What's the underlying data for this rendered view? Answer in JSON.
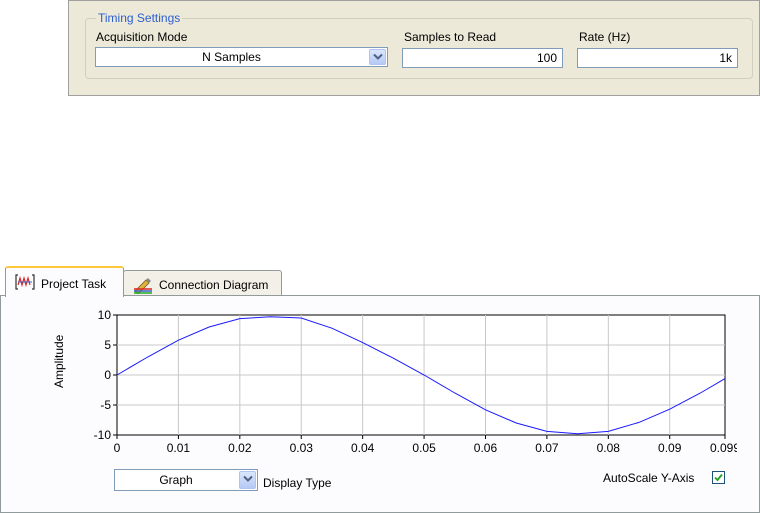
{
  "timing": {
    "group_title": "Timing Settings",
    "acq_mode_label": "Acquisition Mode",
    "acq_mode_value": "N Samples",
    "samples_label": "Samples to Read",
    "samples_value": "100",
    "rate_label": "Rate (Hz)",
    "rate_value": "1k"
  },
  "tabs": [
    {
      "label": "Project Task",
      "icon": "waveform-icon",
      "active": true
    },
    {
      "label": "Connection Diagram",
      "icon": "pencil-wiring-icon",
      "active": false
    }
  ],
  "controls": {
    "display_type_value": "Graph",
    "display_type_label": "Display Type",
    "autoscale_label": "AutoScale Y-Axis",
    "autoscale_checked": true
  },
  "chart_data": {
    "type": "line",
    "ylabel": "Amplitude",
    "xlabel": "",
    "xlim": [
      0,
      0.099
    ],
    "ylim": [
      -10,
      10
    ],
    "x_ticks": [
      "0",
      "0.01",
      "0.02",
      "0.03",
      "0.04",
      "0.05",
      "0.06",
      "0.07",
      "0.08",
      "0.09",
      "0.099"
    ],
    "y_ticks": [
      "10",
      "5",
      "0",
      "-5",
      "-10"
    ],
    "grid": true,
    "series": [
      {
        "color": "#1a1aff",
        "x": [
          0,
          0.005,
          0.01,
          0.015,
          0.02,
          0.025,
          0.03,
          0.035,
          0.04,
          0.045,
          0.05,
          0.055,
          0.06,
          0.065,
          0.07,
          0.075,
          0.08,
          0.085,
          0.09,
          0.095,
          0.099
        ],
        "y": [
          0,
          3.0,
          5.8,
          8.0,
          9.4,
          9.7,
          9.5,
          7.8,
          5.4,
          2.8,
          0,
          -3.0,
          -5.8,
          -8.0,
          -9.4,
          -9.8,
          -9.4,
          -7.9,
          -5.7,
          -3.0,
          -0.6
        ]
      }
    ]
  },
  "colors": {
    "panel_bg": "#ece9d8",
    "group_title": "#2c5fd1",
    "tab_highlight": "#ffc83c",
    "plot_line": "#1a1aff"
  }
}
